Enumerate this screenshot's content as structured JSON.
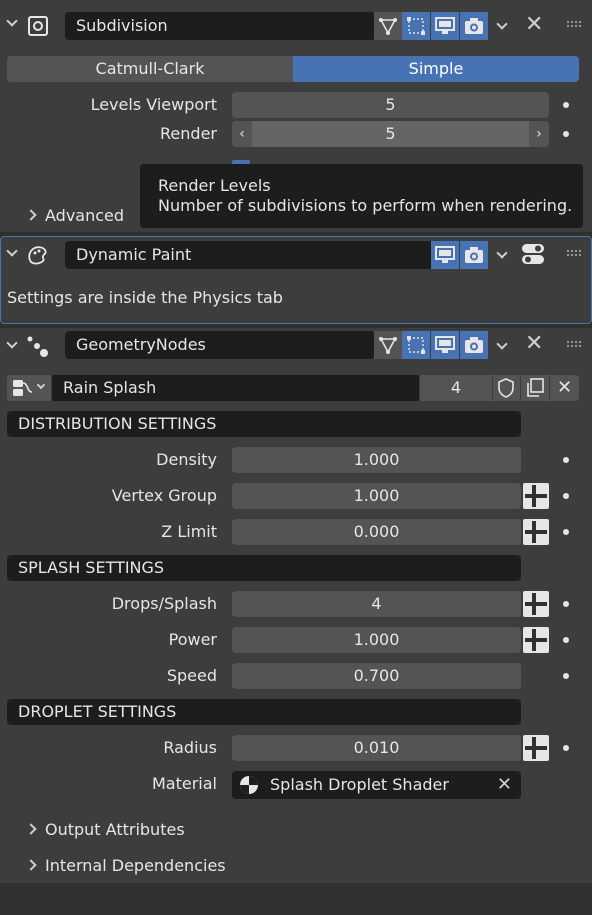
{
  "subdivision": {
    "name": "Subdivision",
    "mode_catmull": "Catmull-Clark",
    "mode_simple": "Simple",
    "levels_viewport_label": "Levels Viewport",
    "levels_viewport_value": "5",
    "render_label": "Render",
    "render_value": "5",
    "advanced_label": "Advanced"
  },
  "tooltip": {
    "title": "Render Levels",
    "description": "Number of subdivisions to perform when rendering."
  },
  "dynamic_paint": {
    "name": "Dynamic Paint",
    "message": "Settings are inside the Physics tab"
  },
  "geometry_nodes": {
    "name": "GeometryNodes",
    "node_group": "Rain Splash",
    "user_count": "4",
    "distribution": {
      "header": "DISTRIBUTION SETTINGS",
      "density_label": "Density",
      "density_value": "1.000",
      "vertex_group_label": "Vertex Group",
      "vertex_group_value": "1.000",
      "z_limit_label": "Z Limit",
      "z_limit_value": "0.000"
    },
    "splash": {
      "header": "SPLASH SETTINGS",
      "drops_label": "Drops/Splash",
      "drops_value": "4",
      "power_label": "Power",
      "power_value": "1.000",
      "speed_label": "Speed",
      "speed_value": "0.700"
    },
    "droplet": {
      "header": "DROPLET SETTINGS",
      "radius_label": "Radius",
      "radius_value": "0.010",
      "material_label": "Material",
      "material_value": "Splash Droplet Shader"
    },
    "output_attributes_label": "Output Attributes",
    "internal_dependencies_label": "Internal Dependencies"
  },
  "colors": {
    "accent": "#4772b3",
    "panel": "#3d3d3d",
    "field": "#545454",
    "dark_field": "#1d1d1d"
  }
}
